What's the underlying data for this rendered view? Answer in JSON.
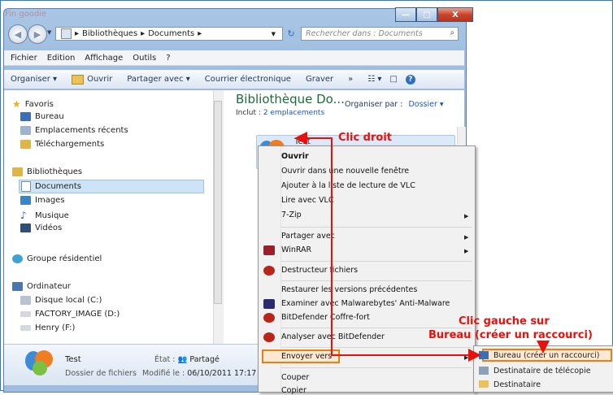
{
  "window": {
    "ghost_title": "Fin goodie",
    "controls": {
      "minimize": "—",
      "maximize": "□",
      "close": "X"
    }
  },
  "address_bar": {
    "back_icon": "◀",
    "forward_icon": "▶",
    "dropdown_icon": "▼",
    "segments": [
      "Bibliothèques",
      "Documents"
    ],
    "separator": "▸",
    "refresh_icon": "↻",
    "search_placeholder": "Rechercher dans : Documents",
    "search_icon": "⌕"
  },
  "menubar": [
    "Fichier",
    "Edition",
    "Affichage",
    "Outils",
    "?"
  ],
  "toolbar": {
    "organiser": "Organiser ▾",
    "ouvrir": "Ouvrir",
    "partager": "Partager avec ▾",
    "courrier": "Courrier électronique",
    "graver": "Graver",
    "more": "»",
    "view_icon": "☷ ▾",
    "pane_icon": "□",
    "help_icon": "?"
  },
  "sidebar": {
    "favoris": "Favoris",
    "bureau": "Bureau",
    "emplacements": "Emplacements récents",
    "telechargements": "Téléchargements",
    "bibliotheques": "Bibliothèques",
    "documents": "Documents",
    "images": "Images",
    "musique": "Musique",
    "videos": "Vidéos",
    "groupe": "Groupe résidentiel",
    "ordinateur": "Ordinateur",
    "disque_c": "Disque local (C:)",
    "factory_d": "FACTORY_IMAGE (D:)",
    "henry_f": "Henry (F:)"
  },
  "library": {
    "title": "Bibliothèque Do...",
    "inclut_label": "Inclut :",
    "inclut_link": "2 emplacements",
    "organiser_par": "Organiser par :",
    "dossier": "Dossier ▾",
    "item_name": "Test"
  },
  "status": {
    "name": "Test",
    "etat_label": "État :",
    "etat_value": "Partagé",
    "type": "Dossier de fichiers",
    "modifie_label": "Modifié le :",
    "modifie_value": "06/10/2011 17:17"
  },
  "context_menu": {
    "ouvrir": "Ouvrir",
    "nouvelle_fenetre": "Ouvrir dans une nouvelle fenêtre",
    "vlc_list": "Ajouter à la liste de lecture de VLC",
    "lire_vlc": "Lire avec VLC",
    "zip": "7-Zip",
    "partager": "Partager avec",
    "winrar": "WinRAR",
    "destructeur": "Destructeur fichiers",
    "restaurer": "Restaurer les versions précédentes",
    "malwarebytes": "Examiner avec Malwarebytes' Anti-Malware",
    "bitdefender_coffre": "BitDefender Coffre-fort",
    "analyser": "Analyser avec BitDefender",
    "envoyer": "Envoyer vers",
    "couper": "Couper",
    "copier": "Copier"
  },
  "submenu": {
    "bureau": "Bureau (créer un raccourci)",
    "telecopie": "Destinataire de télécopie",
    "destinataire": "Destinataire"
  },
  "annotations": {
    "clic_droit": "Clic droit",
    "clic_gauche_1": "Clic gauche sur",
    "clic_gauche_2": "Bureau (créer un raccourci)"
  },
  "colors": {
    "annotation": "#e8110c",
    "library_title": "#1e6b3a",
    "selection": "#cde4f7"
  }
}
